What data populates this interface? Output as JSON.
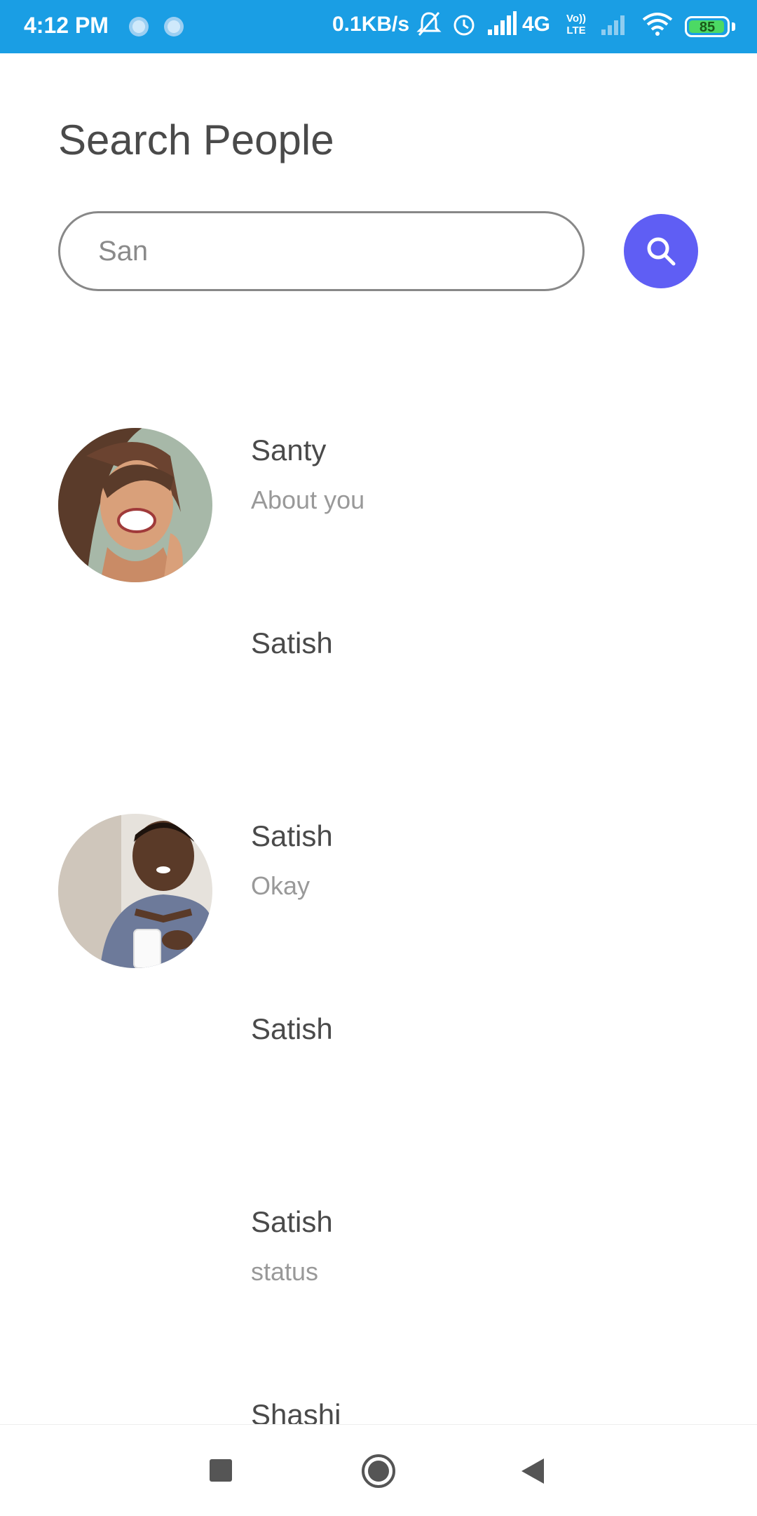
{
  "status_bar": {
    "time": "4:12 PM",
    "net_speed": "0.1KB/s",
    "network": "4G",
    "volte_line1": "Vo))",
    "volte_line2": "LTE",
    "battery": "85"
  },
  "page": {
    "title": "Search People"
  },
  "search": {
    "value": "San",
    "button_icon": "search-icon"
  },
  "results": [
    {
      "name": "Santy",
      "status": "About you",
      "avatar": "woman-photo"
    },
    {
      "name": "Satish",
      "status": ""
    },
    {
      "name": "Satish",
      "status": "Okay",
      "avatar": "man-photo"
    },
    {
      "name": "Satish",
      "status": ""
    },
    {
      "name": "Satish",
      "status": "status"
    },
    {
      "name": "Shashi",
      "status": ""
    }
  ],
  "nav": {
    "recents": "square-icon",
    "home": "circle-icon",
    "back": "triangle-icon"
  },
  "colors": {
    "status_bar": "#1a9ee4",
    "accent": "#5f5ef4"
  }
}
